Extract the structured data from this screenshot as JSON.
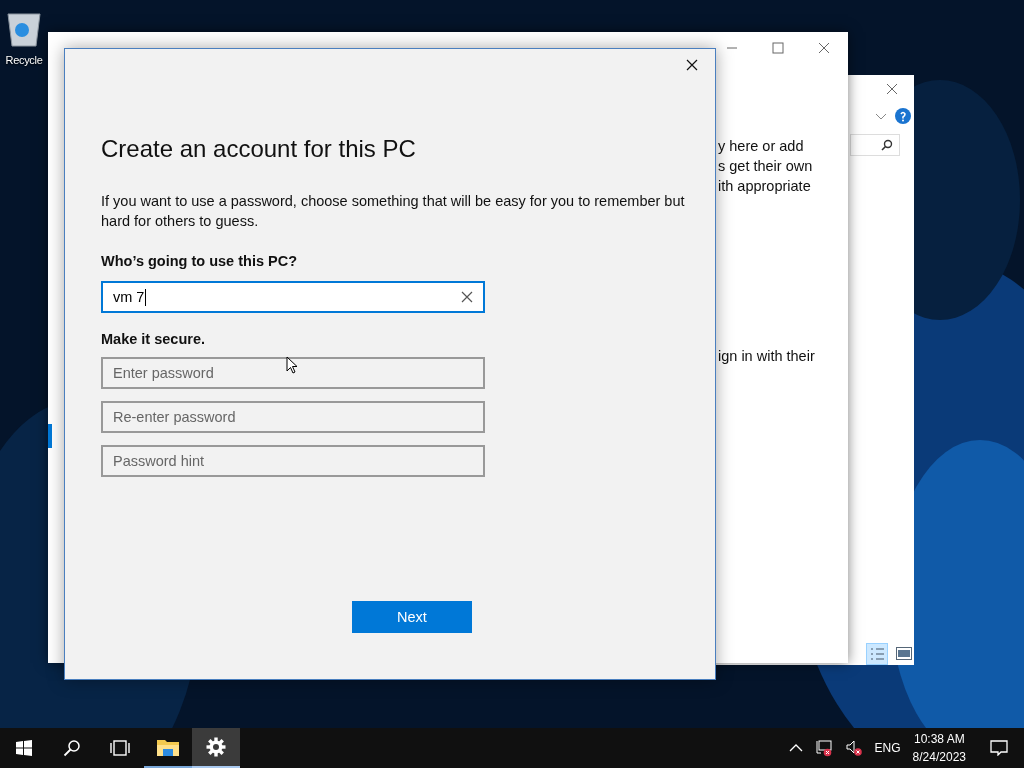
{
  "desktop": {
    "icons": [
      {
        "label": "Recycle"
      }
    ]
  },
  "back_window": {
    "kind": "explorer"
  },
  "settings_window": {
    "text_lines": [
      "y here or add",
      "s get their own",
      "ith appropriate"
    ],
    "text_lines_2": [
      "ign in with their"
    ]
  },
  "dialog": {
    "heading": "Create an account for this PC",
    "description": "If you want to use a password, choose something that will be easy for you to remember but hard for others to guess.",
    "name_label": "Who’s going to use this PC?",
    "name_field": {
      "value": "vm 7"
    },
    "secure_label": "Make it secure.",
    "fields": [
      {
        "placeholder": "Enter password"
      },
      {
        "placeholder": "Re-enter password"
      },
      {
        "placeholder": "Password hint"
      }
    ],
    "next_button": "Next"
  },
  "taskbar": {
    "apps": [
      {
        "kind": "explorer",
        "selected": false
      },
      {
        "kind": "settings",
        "selected": true
      }
    ],
    "language": "ENG",
    "time": "10:38 AM",
    "date": "8/24/2023"
  }
}
